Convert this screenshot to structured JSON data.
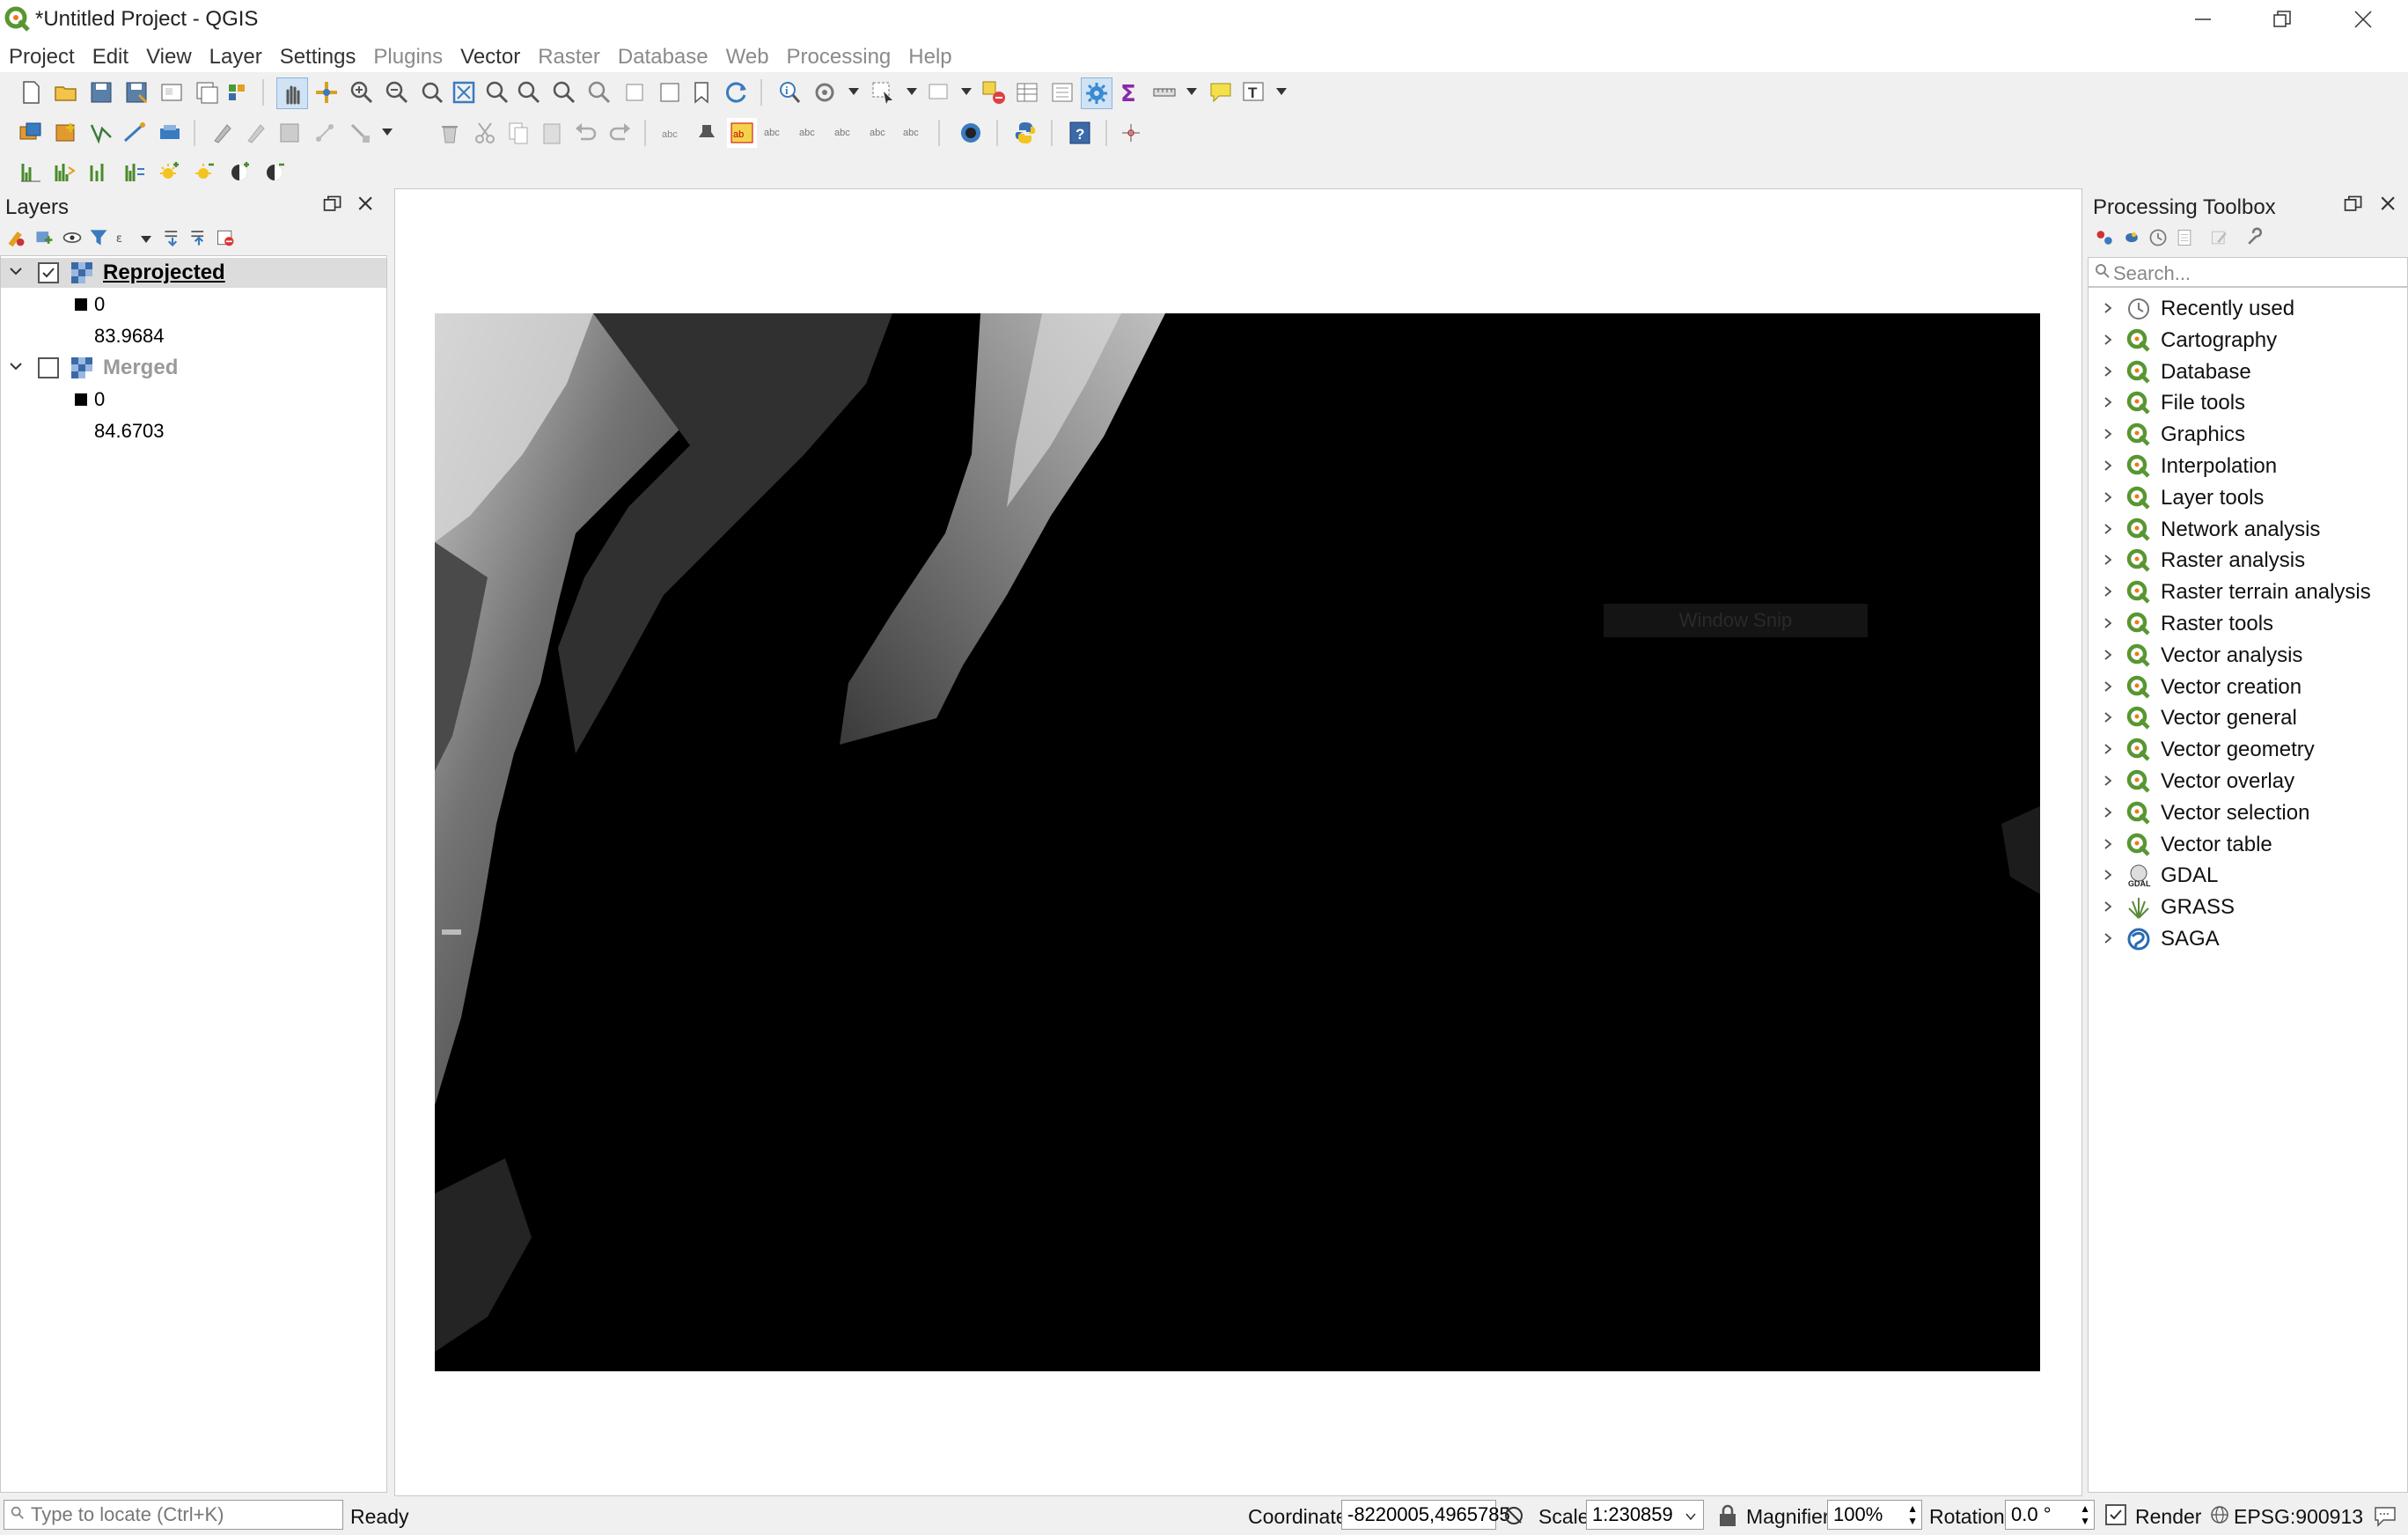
{
  "window": {
    "title": "*Untitled Project - QGIS",
    "controls": [
      "minimize",
      "restore",
      "close"
    ]
  },
  "menubar": {
    "items": [
      {
        "label": "Project",
        "enabled": true
      },
      {
        "label": "Edit",
        "enabled": true
      },
      {
        "label": "View",
        "enabled": true
      },
      {
        "label": "Layer",
        "enabled": true
      },
      {
        "label": "Settings",
        "enabled": true
      },
      {
        "label": "Plugins",
        "enabled": false
      },
      {
        "label": "Vector",
        "enabled": true
      },
      {
        "label": "Raster",
        "enabled": false
      },
      {
        "label": "Database",
        "enabled": false
      },
      {
        "label": "Web",
        "enabled": false
      },
      {
        "label": "Processing",
        "enabled": false
      },
      {
        "label": "Help",
        "enabled": false
      }
    ]
  },
  "layers_panel": {
    "title": "Layers",
    "layers": [
      {
        "name": "Reprojected",
        "checked": true,
        "expanded": true,
        "legend": {
          "min_label": "0",
          "max_label": "83.9684"
        }
      },
      {
        "name": "Merged",
        "checked": false,
        "expanded": true,
        "legend": {
          "min_label": "0",
          "max_label": "84.6703"
        }
      }
    ]
  },
  "map": {
    "overlay_text": "Window Snip"
  },
  "processing_toolbox": {
    "title": "Processing Toolbox",
    "search_placeholder": "Search...",
    "groups": [
      {
        "label": "Recently used",
        "icon": "clock-icon"
      },
      {
        "label": "Cartography",
        "icon": "qgis-icon"
      },
      {
        "label": "Database",
        "icon": "qgis-icon"
      },
      {
        "label": "File tools",
        "icon": "qgis-icon"
      },
      {
        "label": "Graphics",
        "icon": "qgis-icon"
      },
      {
        "label": "Interpolation",
        "icon": "qgis-icon"
      },
      {
        "label": "Layer tools",
        "icon": "qgis-icon"
      },
      {
        "label": "Network analysis",
        "icon": "qgis-icon"
      },
      {
        "label": "Raster analysis",
        "icon": "qgis-icon"
      },
      {
        "label": "Raster terrain analysis",
        "icon": "qgis-icon"
      },
      {
        "label": "Raster tools",
        "icon": "qgis-icon"
      },
      {
        "label": "Vector analysis",
        "icon": "qgis-icon"
      },
      {
        "label": "Vector creation",
        "icon": "qgis-icon"
      },
      {
        "label": "Vector general",
        "icon": "qgis-icon"
      },
      {
        "label": "Vector geometry",
        "icon": "qgis-icon"
      },
      {
        "label": "Vector overlay",
        "icon": "qgis-icon"
      },
      {
        "label": "Vector selection",
        "icon": "qgis-icon"
      },
      {
        "label": "Vector table",
        "icon": "qgis-icon"
      },
      {
        "label": "GDAL",
        "icon": "gdal-icon"
      },
      {
        "label": "GRASS",
        "icon": "grass-icon"
      },
      {
        "label": "SAGA",
        "icon": "saga-icon"
      }
    ]
  },
  "statusbar": {
    "locator_placeholder": "Type to locate (Ctrl+K)",
    "status": "Ready",
    "coordinate_label": "Coordinate",
    "coordinate_value": "-8220005,4965785",
    "scale_label": "Scale",
    "scale_value": "1:230859",
    "magnifier_label": "Magnifier",
    "magnifier_value": "100%",
    "rotation_label": "Rotation",
    "rotation_value": "0.0 °",
    "render_label": "Render",
    "render_checked": true,
    "crs": "EPSG:900913"
  },
  "colors": {
    "qgis_green": "#589632",
    "qgis_yellow": "#ee7913",
    "map_background": "#000000"
  }
}
